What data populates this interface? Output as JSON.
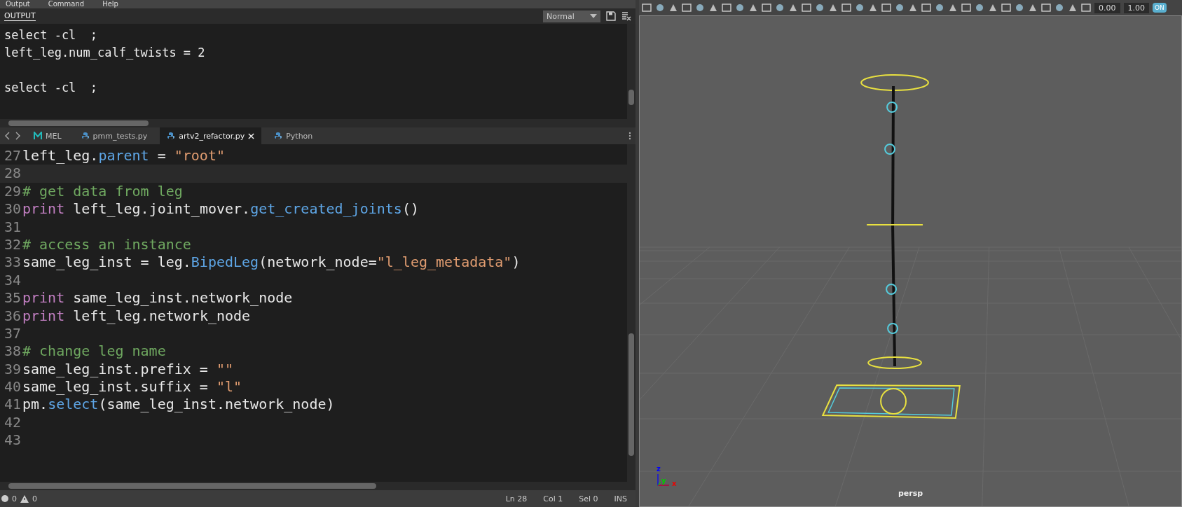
{
  "menu": [
    "Output",
    "Command",
    "Help"
  ],
  "output_panel": {
    "tab": "OUTPUT",
    "mode": "Normal",
    "text": "select -cl  ;\nleft_leg.num_calf_twists = 2\n\nselect -cl  ;"
  },
  "editor_tabs": [
    {
      "label": "MEL",
      "kind": "mel",
      "selected": false,
      "closable": false
    },
    {
      "label": "pmm_tests.py",
      "kind": "python",
      "selected": false,
      "closable": false
    },
    {
      "label": "artv2_refactor.py",
      "kind": "python",
      "selected": true,
      "closable": true
    },
    {
      "label": "Python",
      "kind": "python",
      "selected": false,
      "closable": false
    }
  ],
  "code_lines": [
    {
      "number": "27",
      "current": false,
      "tokens": [
        {
          "t": "left_leg.",
          "kind": "plain"
        },
        {
          "t": "parent",
          "kind": "attr"
        },
        {
          "t": " = ",
          "kind": "plain"
        },
        {
          "t": "\"root\"",
          "kind": "string"
        }
      ]
    },
    {
      "number": "28",
      "current": true
    },
    {
      "number": "29",
      "current": false,
      "tokens": [
        {
          "t": "# get data from leg",
          "kind": "comment"
        }
      ]
    },
    {
      "number": "30",
      "current": false,
      "tokens": [
        {
          "t": "print",
          "kind": "keyword"
        },
        {
          "t": " left_leg.joint_mover.",
          "kind": "plain"
        },
        {
          "t": "get_created_joints",
          "kind": "attr"
        },
        {
          "t": "()",
          "kind": "plain"
        }
      ]
    },
    {
      "number": "31",
      "current": false
    },
    {
      "number": "32",
      "current": false,
      "tokens": [
        {
          "t": "# access an instance",
          "kind": "comment"
        }
      ]
    },
    {
      "number": "33",
      "current": false,
      "tokens": [
        {
          "t": "same_leg_inst = leg.",
          "kind": "plain"
        },
        {
          "t": "BipedLeg",
          "kind": "attr"
        },
        {
          "t": "(network_node=",
          "kind": "plain"
        },
        {
          "t": "\"l_leg_metadata\"",
          "kind": "string"
        },
        {
          "t": ")",
          "kind": "plain"
        }
      ]
    },
    {
      "number": "34",
      "current": false
    },
    {
      "number": "35",
      "current": false,
      "tokens": [
        {
          "t": "print",
          "kind": "keyword"
        },
        {
          "t": " same_leg_inst.network_node",
          "kind": "plain"
        }
      ]
    },
    {
      "number": "36",
      "current": false,
      "tokens": [
        {
          "t": "print",
          "kind": "keyword"
        },
        {
          "t": " left_leg.network_node",
          "kind": "plain"
        }
      ]
    },
    {
      "number": "37",
      "current": false
    },
    {
      "number": "38",
      "current": false,
      "tokens": [
        {
          "t": "# change leg name",
          "kind": "comment"
        }
      ]
    },
    {
      "number": "39",
      "current": false,
      "tokens": [
        {
          "t": "same_leg_inst.prefix = ",
          "kind": "plain"
        },
        {
          "t": "\"\"",
          "kind": "string"
        }
      ]
    },
    {
      "number": "40",
      "current": false,
      "tokens": [
        {
          "t": "same_leg_inst.suffix = ",
          "kind": "plain"
        },
        {
          "t": "\"l\"",
          "kind": "string"
        }
      ]
    },
    {
      "number": "41",
      "current": false,
      "tokens": [
        {
          "t": "pm.",
          "kind": "plain"
        },
        {
          "t": "select",
          "kind": "attr"
        },
        {
          "t": "(same_leg_inst.network_node)",
          "kind": "plain"
        }
      ]
    },
    {
      "number": "42",
      "current": false
    },
    {
      "number": "43",
      "current": false
    }
  ],
  "status_bar": {
    "errors": "0",
    "warnings": "0",
    "line": "Ln 28",
    "column": "Col 1",
    "selection": "Sel 0",
    "mode": "INS"
  },
  "viewport": {
    "exposure": "0.00",
    "gamma": "1.00",
    "toggle": "ON",
    "camera": "persp",
    "axis_labels": [
      "z",
      "y",
      "x"
    ]
  }
}
